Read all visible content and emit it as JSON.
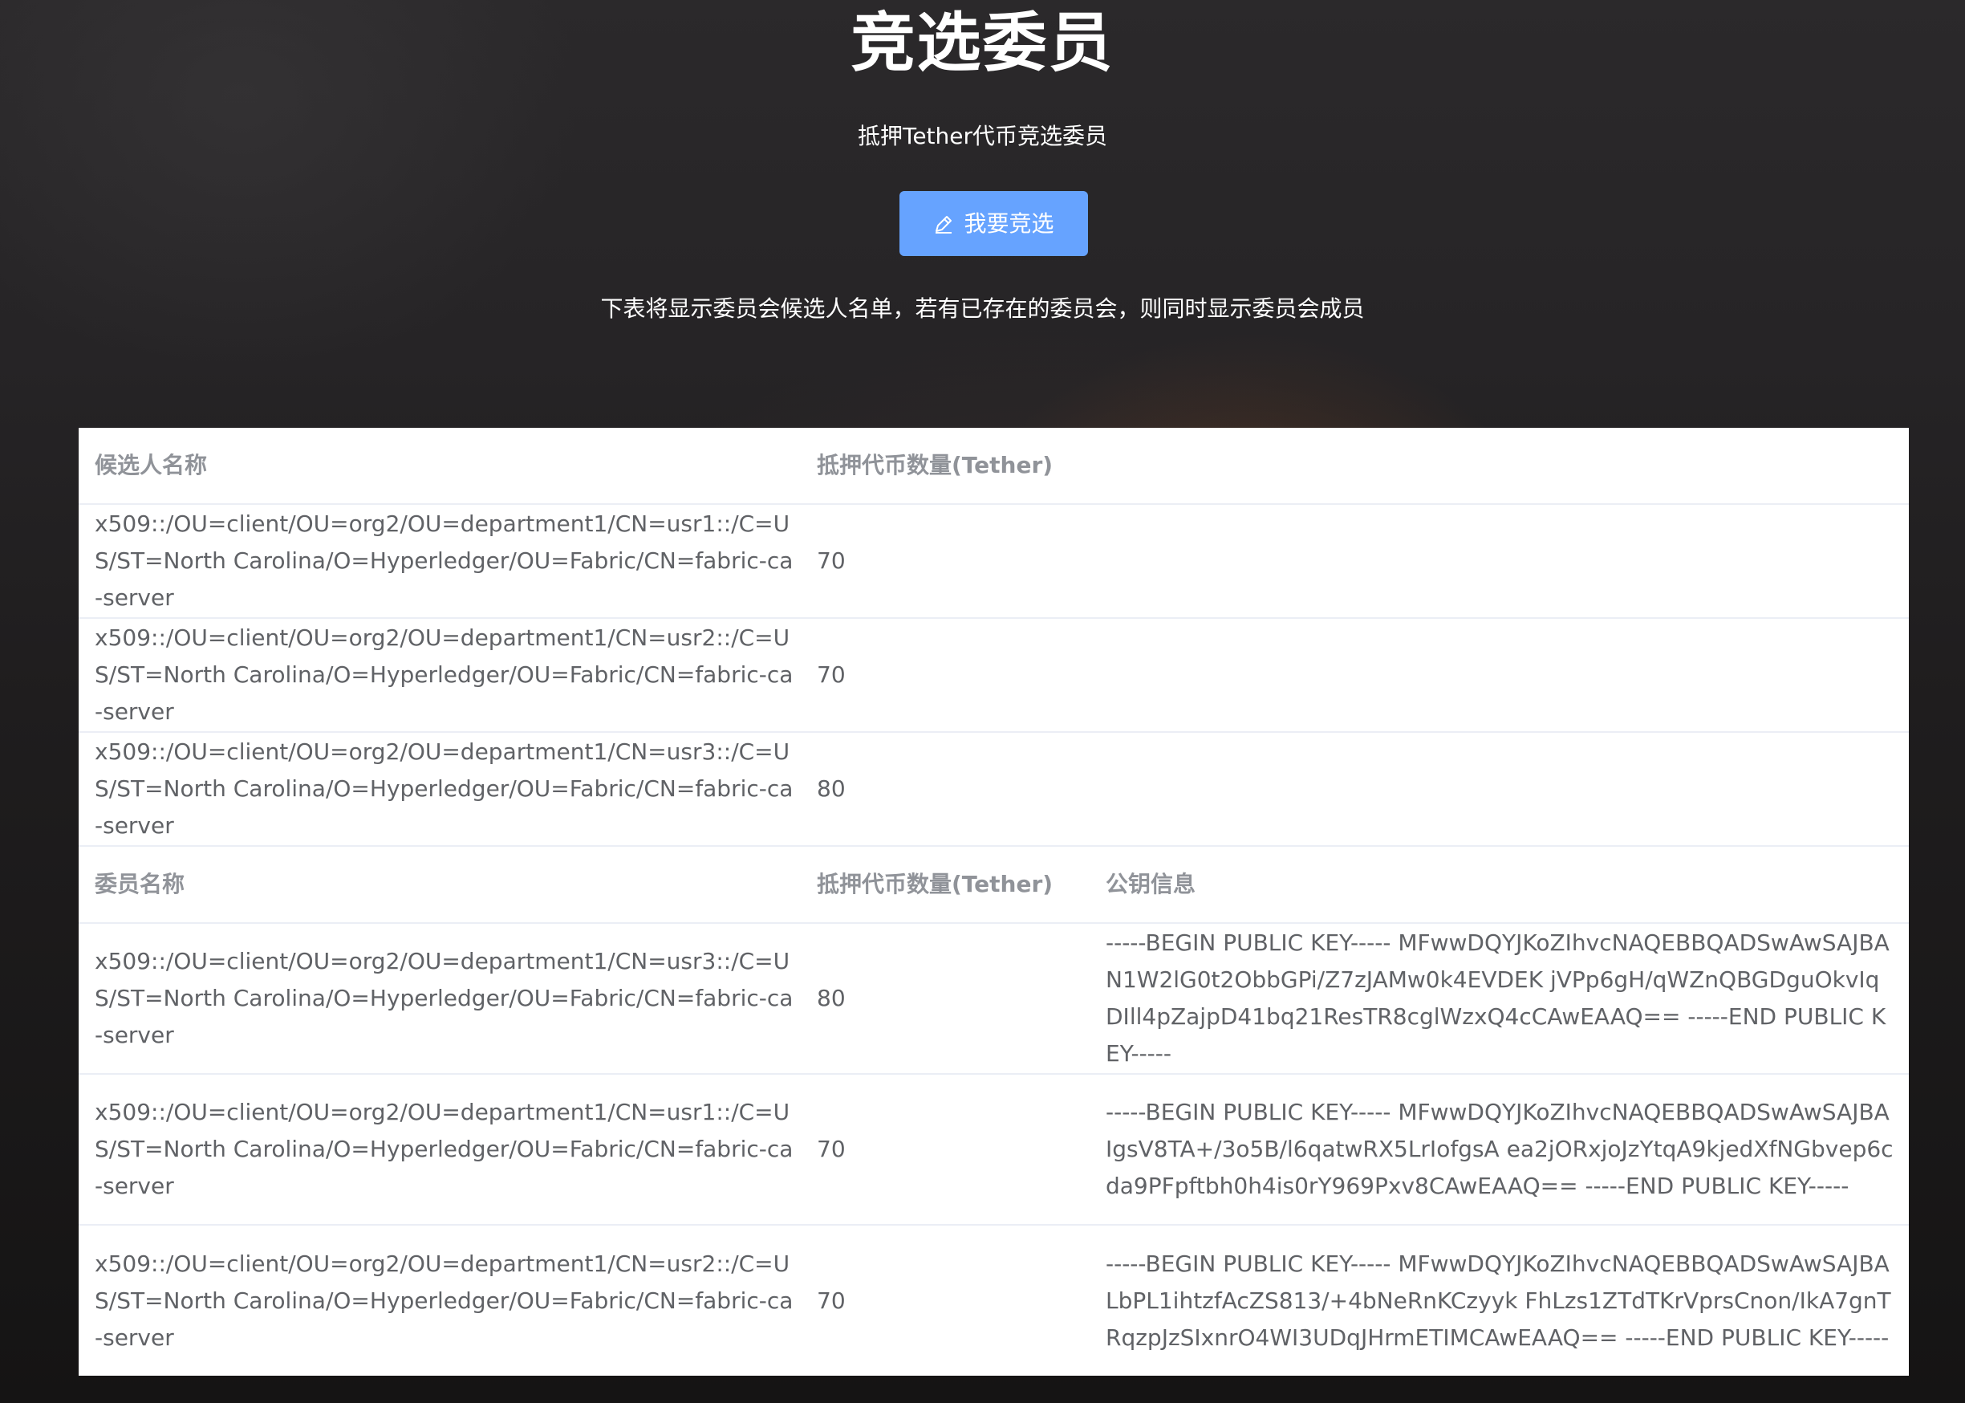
{
  "hero": {
    "title": "竞选委员",
    "subtitle": "抵押Tether代币竞选委员",
    "button_label": "我要竞选",
    "description": "下表将显示委员会候选人名单，若有已存在的委员会，则同时显示委员会成员"
  },
  "candidates": {
    "headers": [
      "候选人名称",
      "抵押代币数量(Tether)"
    ],
    "rows": [
      {
        "name": "x509::/OU=client/OU=org2/OU=department1/CN=usr1::/C=US/ST=North Carolina/O=Hyperledger/OU=Fabric/CN=fabric-ca-server",
        "amount": "70"
      },
      {
        "name": "x509::/OU=client/OU=org2/OU=department1/CN=usr2::/C=US/ST=North Carolina/O=Hyperledger/OU=Fabric/CN=fabric-ca-server",
        "amount": "70"
      },
      {
        "name": "x509::/OU=client/OU=org2/OU=department1/CN=usr3::/C=US/ST=North Carolina/O=Hyperledger/OU=Fabric/CN=fabric-ca-server",
        "amount": "80"
      }
    ]
  },
  "members": {
    "headers": [
      "委员名称",
      "抵押代币数量(Tether)",
      "公钥信息"
    ],
    "rows": [
      {
        "name": "x509::/OU=client/OU=org2/OU=department1/CN=usr3::/C=US/ST=North Carolina/O=Hyperledger/OU=Fabric/CN=fabric-ca-server",
        "amount": "80",
        "key": "-----BEGIN PUBLIC KEY----- MFwwDQYJKoZIhvcNAQEBBQADSwAwSAJBAN1W2lG0t2ObbGPi/Z7zJAMw0k4EVDEK jVPp6gH/qWZnQBGDguOkvIqDIll4pZajpD41bq21ResTR8cglWzxQ4cCAwEAAQ== -----END PUBLIC KEY-----"
      },
      {
        "name": "x509::/OU=client/OU=org2/OU=department1/CN=usr1::/C=US/ST=North Carolina/O=Hyperledger/OU=Fabric/CN=fabric-ca-server",
        "amount": "70",
        "key": "-----BEGIN PUBLIC KEY----- MFwwDQYJKoZIhvcNAQEBBQADSwAwSAJBAIgsV8TA+/3o5B/l6qatwRX5LrIofgsA ea2jORxjoJzYtqA9kjedXfNGbvep6cda9PFpftbh0h4is0rY969Pxv8CAwEAAQ== -----END PUBLIC KEY-----"
      },
      {
        "name": "x509::/OU=client/OU=org2/OU=department1/CN=usr2::/C=US/ST=North Carolina/O=Hyperledger/OU=Fabric/CN=fabric-ca-server",
        "amount": "70",
        "key": "-----BEGIN PUBLIC KEY----- MFwwDQYJKoZIhvcNAQEBBQADSwAwSAJBALbPL1ihtzfAcZS813/+4bNeRnKCzyyk FhLzs1ZTdTKrVprsCnon/IkA7gnTRqzpJzSIxnrO4WI3UDqJHrmETIMCAwEAAQ== -----END PUBLIC KEY-----"
      }
    ]
  }
}
